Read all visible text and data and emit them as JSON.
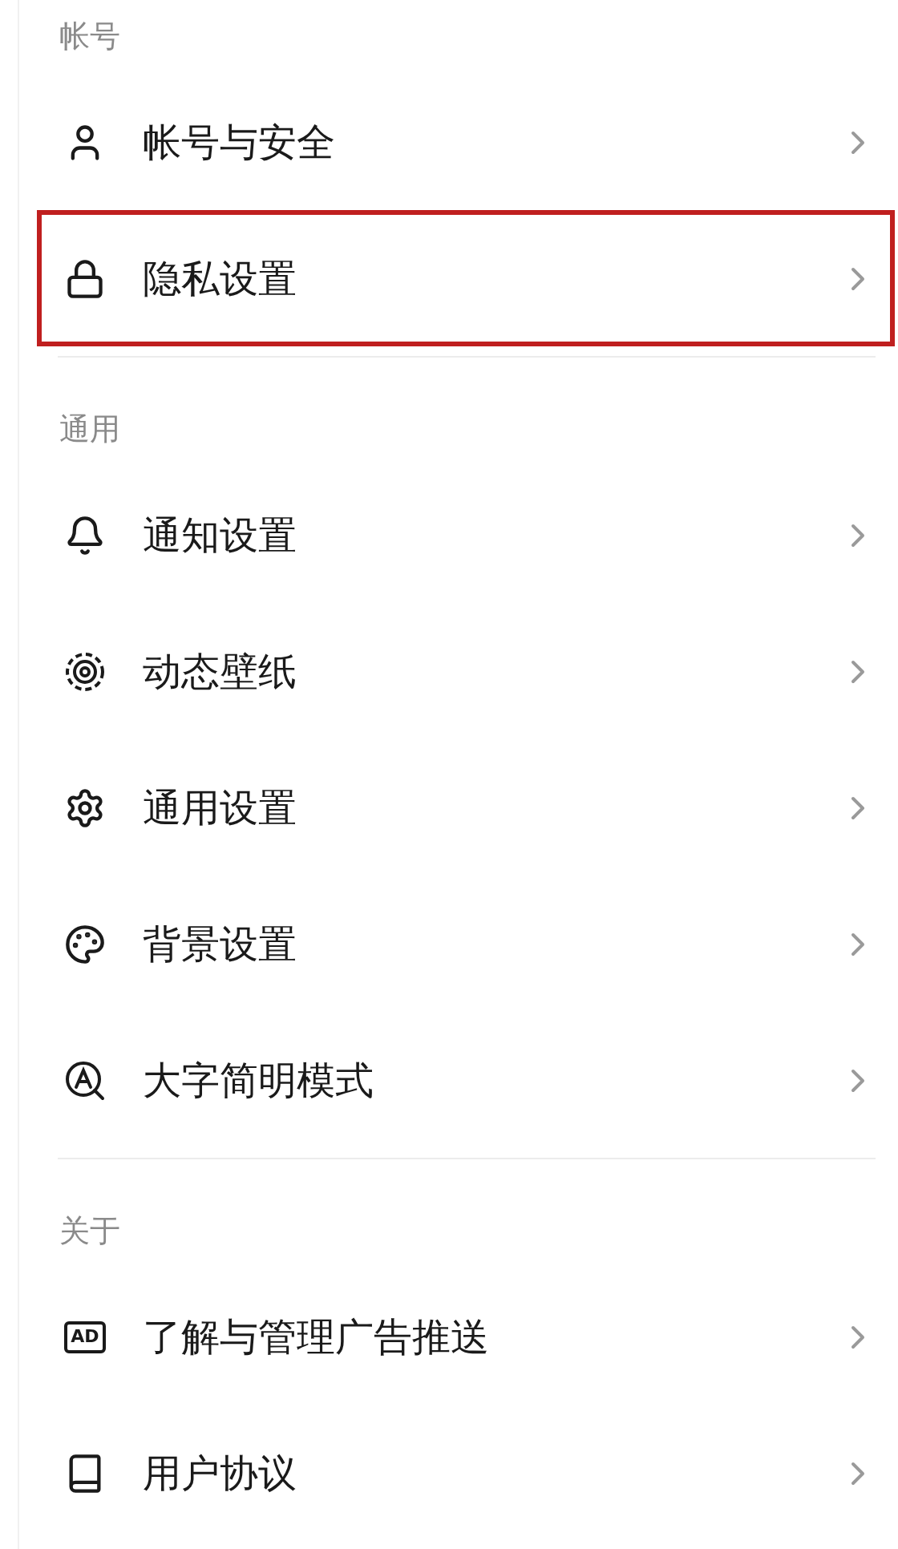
{
  "sections": [
    {
      "title": "帐号",
      "items": [
        {
          "label": "帐号与安全",
          "highlighted": false
        },
        {
          "label": "隐私设置",
          "highlighted": true
        }
      ]
    },
    {
      "title": "通用",
      "items": [
        {
          "label": "通知设置",
          "highlighted": false
        },
        {
          "label": "动态壁纸",
          "highlighted": false
        },
        {
          "label": "通用设置",
          "highlighted": false
        },
        {
          "label": "背景设置",
          "highlighted": false
        },
        {
          "label": "大字简明模式",
          "highlighted": false
        }
      ]
    },
    {
      "title": "关于",
      "items": [
        {
          "icon_text": "AD",
          "label": "了解与管理广告推送",
          "highlighted": false
        },
        {
          "label": "用户协议",
          "highlighted": false
        }
      ]
    }
  ]
}
